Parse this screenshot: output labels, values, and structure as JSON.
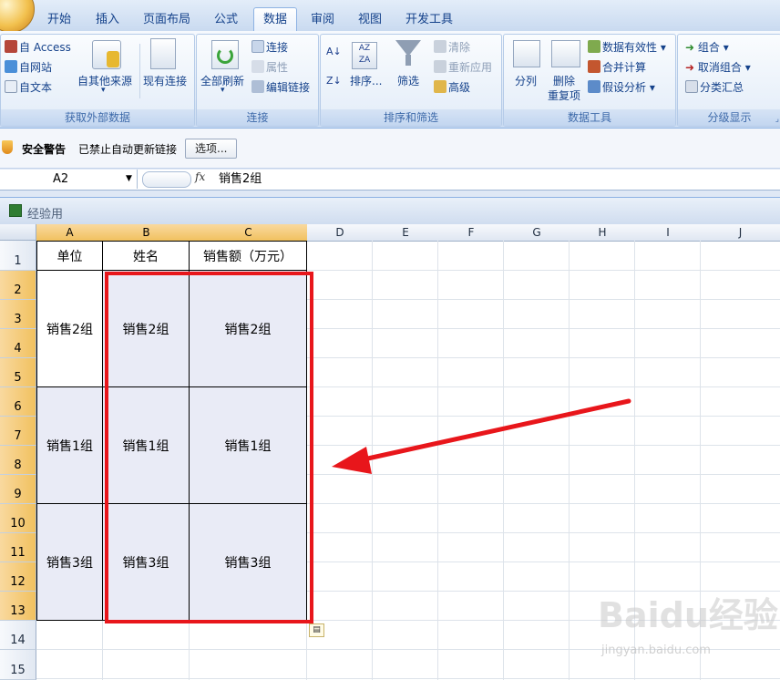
{
  "ribbon_tabs": [
    "开始",
    "插入",
    "页面布局",
    "公式",
    "数据",
    "审阅",
    "视图",
    "开发工具"
  ],
  "active_tab": "数据",
  "groups": {
    "external": {
      "label": "获取外部数据",
      "access": "自 Access",
      "web": "自网站",
      "text": "自文本",
      "other": "自其他来源",
      "existing": "现有连接"
    },
    "connections": {
      "label": "连接",
      "refresh": "全部刷新",
      "connect": "连接",
      "properties": "属性",
      "edit_links": "编辑链接"
    },
    "sort_filter": {
      "label": "排序和筛选",
      "sort": "排序...",
      "filter": "筛选",
      "clear": "清除",
      "reapply": "重新应用",
      "advanced": "高级"
    },
    "data_tools": {
      "label": "数据工具",
      "split": "分列",
      "remove_dup_1": "删除",
      "remove_dup_2": "重复项",
      "validation": "数据有效性",
      "consolidate": "合并计算",
      "whatif": "假设分析"
    },
    "outline": {
      "label": "分级显示",
      "group": "组合",
      "ungroup": "取消组合",
      "subtotal": "分类汇总"
    }
  },
  "security": {
    "title": "安全警告",
    "message": "已禁止自动更新链接",
    "button": "选项..."
  },
  "formula_bar": {
    "name_box": "A2",
    "fx": "fx",
    "content": "销售2组"
  },
  "workbook_title": "经验用",
  "columns": [
    "A",
    "B",
    "C",
    "D",
    "E",
    "F",
    "G",
    "H",
    "I",
    "J"
  ],
  "rows": [
    "1",
    "2",
    "3",
    "4",
    "5",
    "6",
    "7",
    "8",
    "9",
    "10",
    "11",
    "12",
    "13",
    "14",
    "15"
  ],
  "headers": {
    "a": "单位",
    "b": "姓名",
    "c": "销售额（万元）"
  },
  "groups_data": [
    {
      "a": "销售2组",
      "b": "销售2组",
      "c": "销售2组"
    },
    {
      "a": "销售1组",
      "b": "销售1组",
      "c": "销售1组"
    },
    {
      "a": "销售3组",
      "b": "销售3组",
      "c": "销售3组"
    }
  ],
  "watermark": {
    "brand": "Baidu经验",
    "url": "jingyan.baidu.com"
  },
  "colors": {
    "highlight": "#e8161b",
    "selection_header": "#f1c15f",
    "selected_cell_fill": "#e9ebf6"
  }
}
